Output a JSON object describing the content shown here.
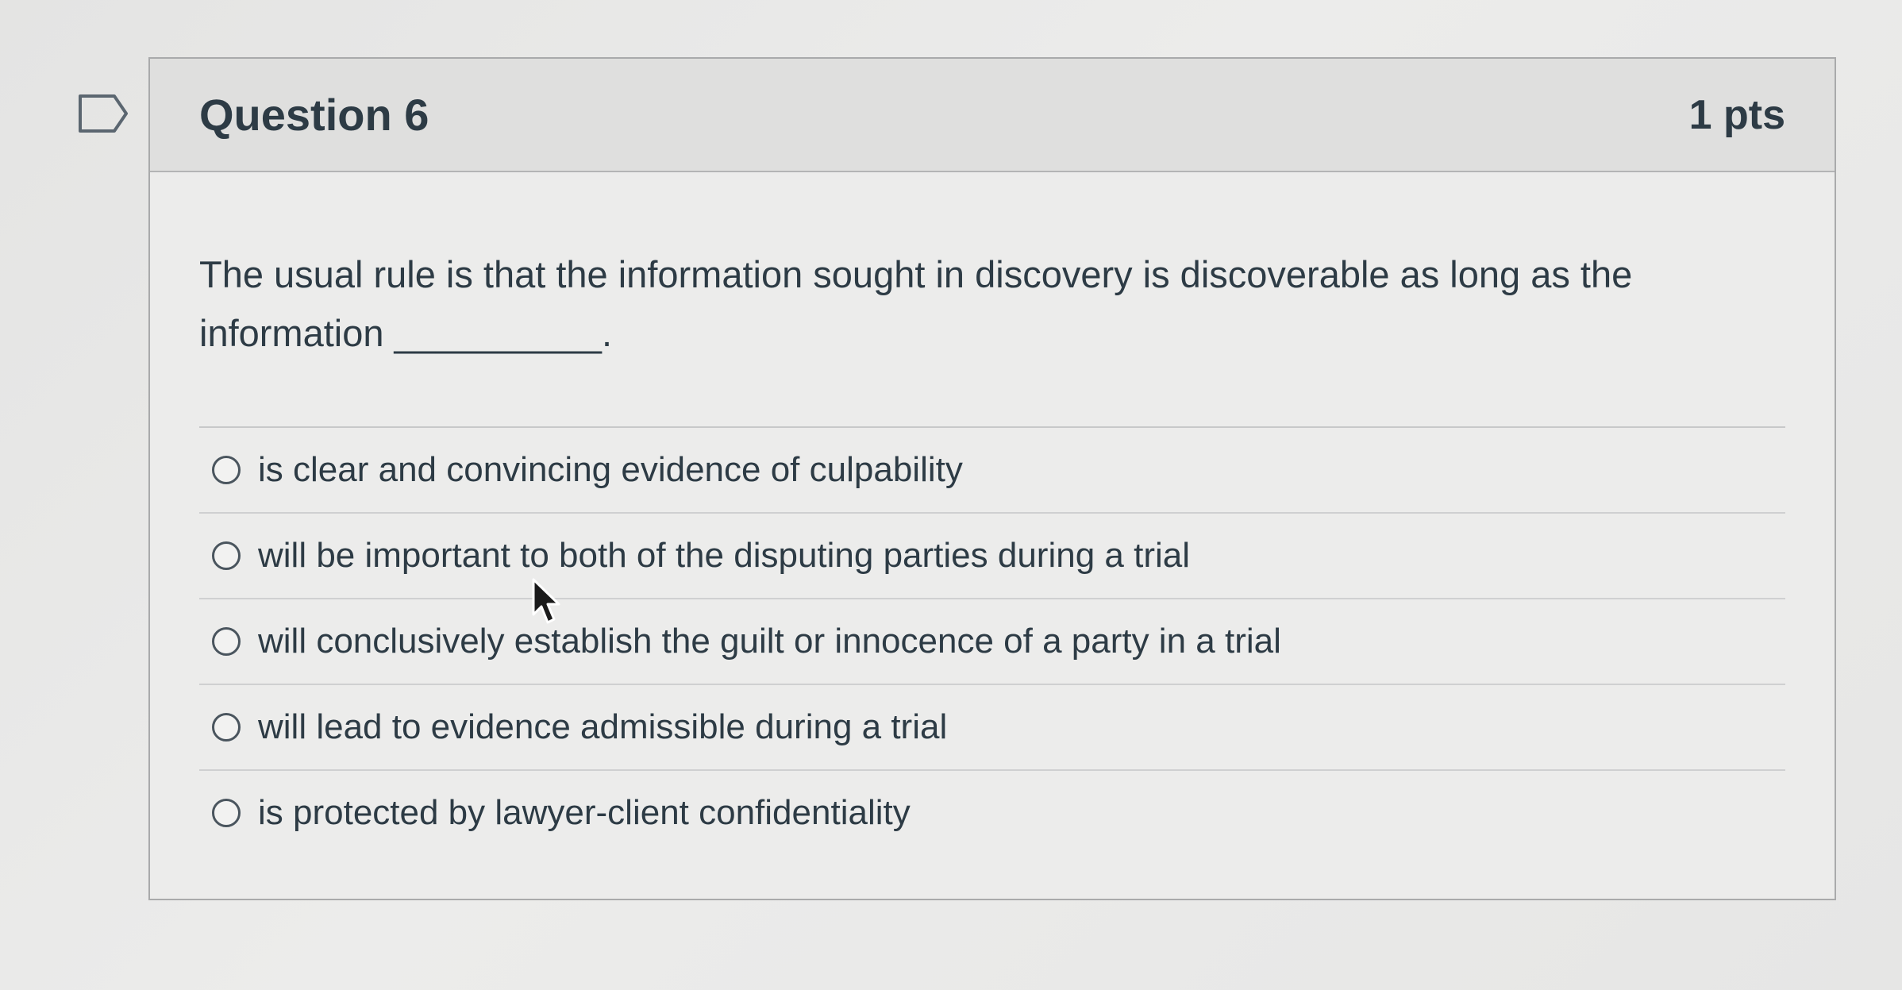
{
  "question": {
    "title": "Question 6",
    "points": "1 pts",
    "text_line1": "The usual rule is that the information sought in discovery is discoverable as long as the",
    "text_line2": "information __________."
  },
  "answers": [
    {
      "label": "is clear and convincing evidence of culpability"
    },
    {
      "label": "will be important to both of the disputing parties during a trial"
    },
    {
      "label": "will conclusively establish the guilt or innocence of a party in a trial"
    },
    {
      "label": "will lead to evidence admissible during a trial"
    },
    {
      "label": "is protected by lawyer-client confidentiality"
    }
  ],
  "icons": {
    "flag": "flag-question-icon",
    "cursor": "mouse-pointer-icon",
    "radio": "radio-unselected-icon"
  },
  "colors": {
    "text": "#2d3b45",
    "header_bg": "#dfdfde",
    "border": "#a9aaab"
  }
}
